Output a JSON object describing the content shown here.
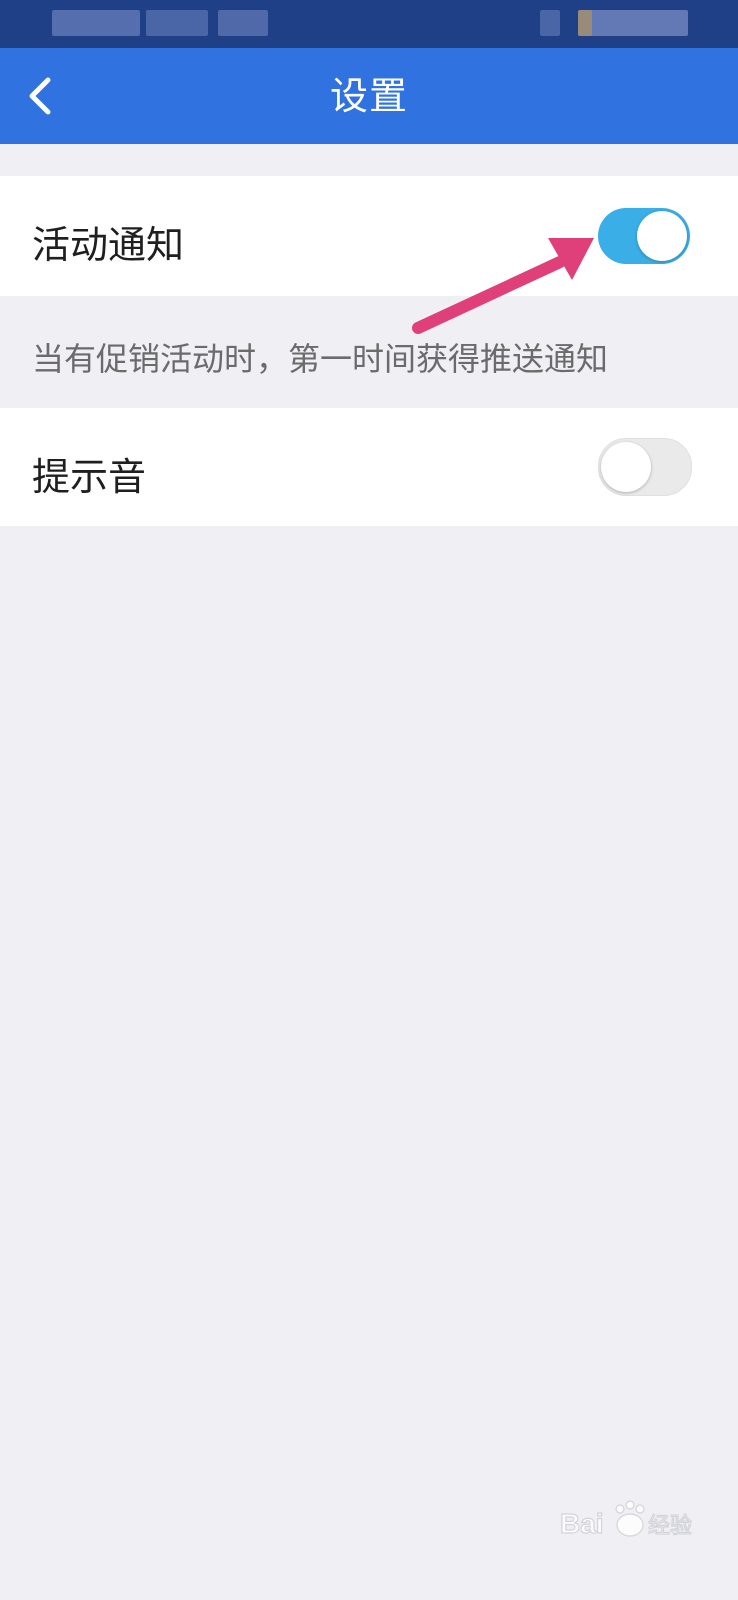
{
  "header": {
    "title": "设置",
    "back_icon": "chevron-left-icon"
  },
  "settings": {
    "activity_notification": {
      "label": "活动通知",
      "enabled": true,
      "description": "当有促销活动时，第一时间获得推送通知"
    },
    "notification_sound": {
      "label": "提示音",
      "enabled": false
    }
  },
  "annotation": {
    "arrow_color": "#e0407a"
  },
  "watermark": {
    "text": "Baidu经验"
  },
  "colors": {
    "status_bar": "#1f3f86",
    "nav_bar": "#2f72e0",
    "toggle_on": "#3aaee6",
    "background": "#efeff4"
  }
}
